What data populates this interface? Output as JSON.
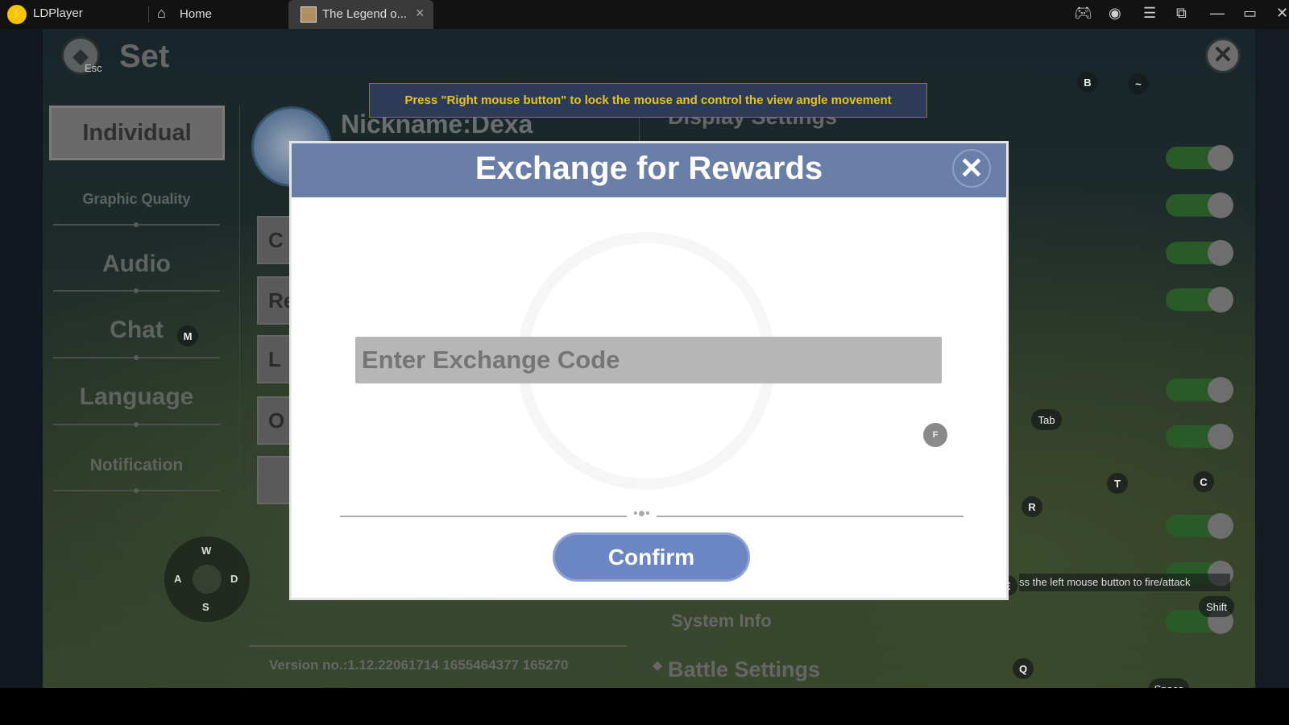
{
  "titlebar": {
    "app_name": "LDPlayer",
    "home_tab": "Home",
    "game_tab": "The Legend o...",
    "tab_close": "×",
    "icons": [
      "gamepad-icon",
      "user-icon",
      "menu-icon",
      "screen-icon",
      "minimize-icon",
      "maximize-icon",
      "close-icon"
    ]
  },
  "settings": {
    "title": "Set",
    "esc_label": "Esc",
    "nickname": "Nickname:Dexa",
    "menu": [
      {
        "label": "Individual"
      },
      {
        "label": "Graphic Quality"
      },
      {
        "label": "Audio"
      },
      {
        "label": "Chat",
        "key": "M"
      },
      {
        "label": "Language"
      },
      {
        "label": "Notification"
      }
    ],
    "left_buttons": [
      "C",
      "Re",
      "L",
      "O",
      ""
    ],
    "display_settings": "Display Settings",
    "system_info": "System Info",
    "battle_settings": "Battle Settings",
    "version": "Version no.:1.12.22061714 1655464377 165270",
    "toggles_on": [
      true,
      true,
      true,
      true,
      true,
      true,
      true,
      true,
      true
    ]
  },
  "tooltip": "Press \"Right mouse button\" to lock the mouse and control the view angle movement",
  "keys": {
    "B": "B",
    "tilde": "~",
    "tab": "Tab",
    "T": "T",
    "C": "C",
    "R": "R",
    "E": "E",
    "shift": "Shift",
    "Q": "Q",
    "space": "Space",
    "F": "F",
    "W": "W",
    "A": "A",
    "S": "S",
    "D": "D"
  },
  "fire_hint": "ss the left mouse button to fire/attack",
  "modal": {
    "title": "Exchange for Rewards",
    "placeholder": "Enter Exchange Code",
    "value": "",
    "confirm": "Confirm"
  },
  "colors": {
    "modal_header": "#6a7fa8",
    "confirm": "#6b86c2",
    "tooltip_text": "#e8c020",
    "toggle_on": "#2a5a28"
  }
}
